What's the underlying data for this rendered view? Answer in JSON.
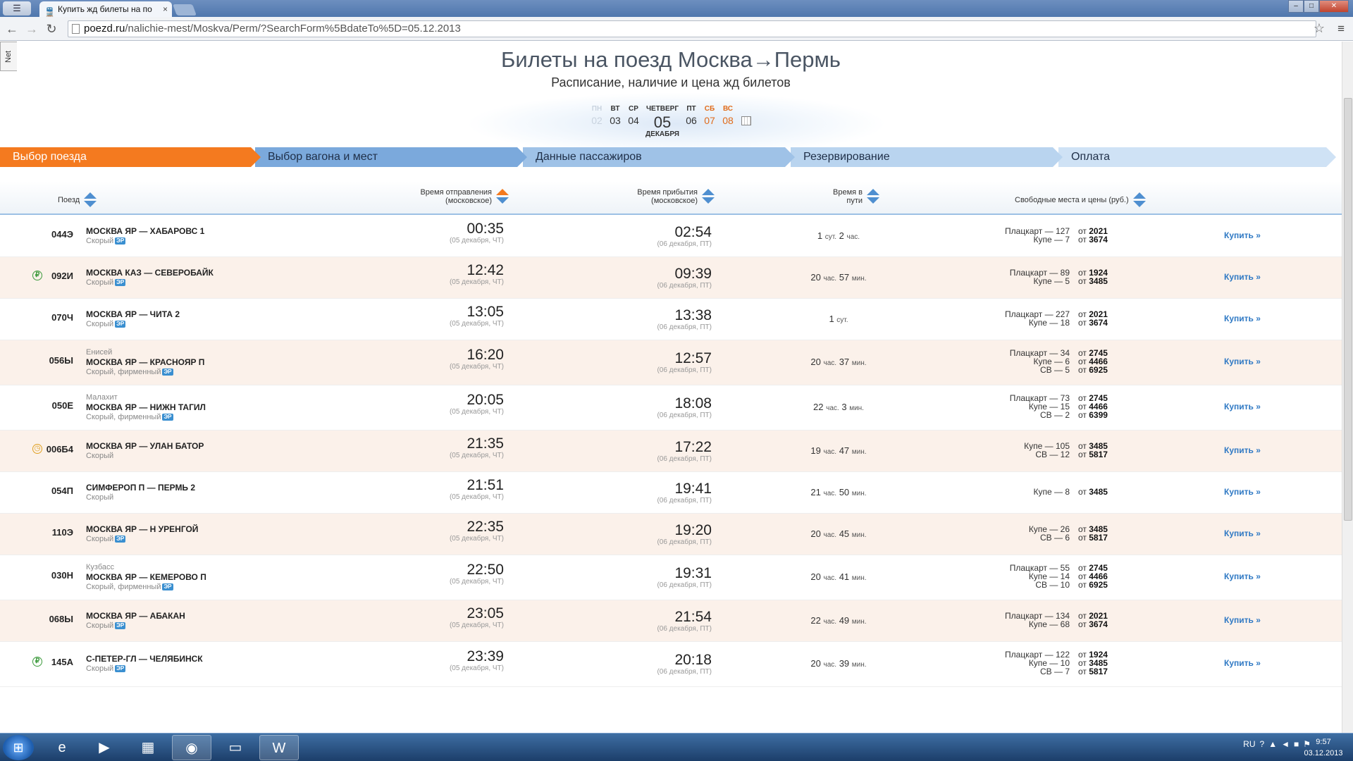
{
  "browser": {
    "tab_title": "Купить жд билеты на по",
    "url_host": "poezd.ru",
    "url_path": "/nalichie-mest/Moskva/Perm/?SearchForm%5BdateTo%5D=05.12.2013",
    "side_tab": "Net"
  },
  "page": {
    "title": "Билеты на поезд Москва→Пермь",
    "subtitle": "Расписание, наличие и цена жд билетов",
    "days": [
      {
        "name": "ПН",
        "date": "02",
        "state": "past"
      },
      {
        "name": "ВТ",
        "date": "03",
        "state": "normal"
      },
      {
        "name": "СР",
        "date": "04",
        "state": "normal"
      },
      {
        "name": "ЧЕТВЕРГ",
        "date": "05",
        "month": "ДЕКАБРЯ",
        "state": "selected"
      },
      {
        "name": "ПТ",
        "date": "06",
        "state": "normal"
      },
      {
        "name": "СБ",
        "date": "07",
        "state": "weekend"
      },
      {
        "name": "ВС",
        "date": "08",
        "state": "weekend"
      }
    ],
    "steps": [
      "Выбор поезда",
      "Выбор вагона и мест",
      "Данные пассажиров",
      "Резервирование",
      "Оплата"
    ],
    "headers": {
      "train": "Поезд",
      "departure": "Время отправления (московское)",
      "arrival": "Время прибытия (московское)",
      "duration": "Время в пути",
      "seats": "Свободные места и цены (руб.)"
    }
  },
  "trains": [
    {
      "num": "044Э",
      "badge": "",
      "brand": "",
      "route": "МОСКВА ЯР — ХАБАРОВС 1",
      "type": "Скорый",
      "er": true,
      "dep": "00:35",
      "dep_date": "(05 декабря, ЧТ)",
      "arr": "02:54",
      "arr_date": "(06 декабря, ПТ)",
      "dur_a": "1",
      "dur_au": "сут.",
      "dur_b": "2",
      "dur_bu": "час.",
      "seats": [
        [
          "Плацкарт — 127",
          "2021"
        ],
        [
          "Купе — 7",
          "3674"
        ]
      ],
      "buy": "Купить »"
    },
    {
      "num": "092И",
      "badge": "r",
      "brand": "",
      "route": "МОСКВА КАЗ — СЕВЕРОБАЙК",
      "type": "Скорый",
      "er": true,
      "dep": "12:42",
      "dep_date": "(05 декабря, ЧТ)",
      "arr": "09:39",
      "arr_date": "(06 декабря, ПТ)",
      "dur_a": "20",
      "dur_au": "час.",
      "dur_b": "57",
      "dur_bu": "мин.",
      "seats": [
        [
          "Плацкарт — 89",
          "1924"
        ],
        [
          "Купе — 5",
          "3485"
        ]
      ],
      "buy": "Купить »"
    },
    {
      "num": "070Ч",
      "badge": "",
      "brand": "",
      "route": "МОСКВА ЯР — ЧИТА 2",
      "type": "Скорый",
      "er": true,
      "dep": "13:05",
      "dep_date": "(05 декабря, ЧТ)",
      "arr": "13:38",
      "arr_date": "(06 декабря, ПТ)",
      "dur_a": "1",
      "dur_au": "сут.",
      "dur_b": "",
      "dur_bu": "",
      "seats": [
        [
          "Плацкарт — 227",
          "2021"
        ],
        [
          "Купе — 18",
          "3674"
        ]
      ],
      "buy": "Купить »"
    },
    {
      "num": "056Ы",
      "badge": "",
      "brand": "Енисей",
      "route": "МОСКВА ЯР — КРАСНОЯР П",
      "type": "Скорый, фирменный",
      "er": true,
      "dep": "16:20",
      "dep_date": "(05 декабря, ЧТ)",
      "arr": "12:57",
      "arr_date": "(06 декабря, ПТ)",
      "dur_a": "20",
      "dur_au": "час.",
      "dur_b": "37",
      "dur_bu": "мин.",
      "seats": [
        [
          "Плацкарт — 34",
          "2745"
        ],
        [
          "Купе — 6",
          "4466"
        ],
        [
          "СВ — 5",
          "6925"
        ]
      ],
      "buy": "Купить »"
    },
    {
      "num": "050Е",
      "badge": "",
      "brand": "Малахит",
      "route": "МОСКВА ЯР — НИЖН ТАГИЛ",
      "type": "Скорый, фирменный",
      "er": true,
      "dep": "20:05",
      "dep_date": "(05 декабря, ЧТ)",
      "arr": "18:08",
      "arr_date": "(06 декабря, ПТ)",
      "dur_a": "22",
      "dur_au": "час.",
      "dur_b": "3",
      "dur_bu": "мин.",
      "seats": [
        [
          "Плацкарт — 73",
          "2745"
        ],
        [
          "Купе — 15",
          "4466"
        ],
        [
          "СВ — 2",
          "6399"
        ]
      ],
      "buy": "Купить »"
    },
    {
      "num": "006Б4",
      "badge": "c",
      "brand": "",
      "route": "МОСКВА ЯР — УЛАН БАТОР",
      "type": "Скорый",
      "er": false,
      "dep": "21:35",
      "dep_date": "(05 декабря, ЧТ)",
      "arr": "17:22",
      "arr_date": "(06 декабря, ПТ)",
      "dur_a": "19",
      "dur_au": "час.",
      "dur_b": "47",
      "dur_bu": "мин.",
      "seats": [
        [
          "Купе — 105",
          "3485"
        ],
        [
          "СВ — 12",
          "5817"
        ]
      ],
      "buy": "Купить »"
    },
    {
      "num": "054П",
      "badge": "",
      "brand": "",
      "route": "СИМФЕРОП П — ПЕРМЬ 2",
      "type": "Скорый",
      "er": false,
      "dep": "21:51",
      "dep_date": "(05 декабря, ЧТ)",
      "arr": "19:41",
      "arr_date": "(06 декабря, ПТ)",
      "dur_a": "21",
      "dur_au": "час.",
      "dur_b": "50",
      "dur_bu": "мин.",
      "seats": [
        [
          "Купе — 8",
          "3485"
        ]
      ],
      "buy": "Купить »"
    },
    {
      "num": "110Э",
      "badge": "",
      "brand": "",
      "route": "МОСКВА ЯР — Н УРЕНГОЙ",
      "type": "Скорый",
      "er": true,
      "dep": "22:35",
      "dep_date": "(05 декабря, ЧТ)",
      "arr": "19:20",
      "arr_date": "(06 декабря, ПТ)",
      "dur_a": "20",
      "dur_au": "час.",
      "dur_b": "45",
      "dur_bu": "мин.",
      "seats": [
        [
          "Купе — 26",
          "3485"
        ],
        [
          "СВ — 6",
          "5817"
        ]
      ],
      "buy": "Купить »"
    },
    {
      "num": "030Н",
      "badge": "",
      "brand": "Кузбасс",
      "route": "МОСКВА ЯР — КЕМЕРОВО П",
      "type": "Скорый, фирменный",
      "er": true,
      "dep": "22:50",
      "dep_date": "(05 декабря, ЧТ)",
      "arr": "19:31",
      "arr_date": "(06 декабря, ПТ)",
      "dur_a": "20",
      "dur_au": "час.",
      "dur_b": "41",
      "dur_bu": "мин.",
      "seats": [
        [
          "Плацкарт — 55",
          "2745"
        ],
        [
          "Купе — 14",
          "4466"
        ],
        [
          "СВ — 10",
          "6925"
        ]
      ],
      "buy": "Купить »"
    },
    {
      "num": "068Ы",
      "badge": "",
      "brand": "",
      "route": "МОСКВА ЯР — АБАКАН",
      "type": "Скорый",
      "er": true,
      "dep": "23:05",
      "dep_date": "(05 декабря, ЧТ)",
      "arr": "21:54",
      "arr_date": "(06 декабря, ПТ)",
      "dur_a": "22",
      "dur_au": "час.",
      "dur_b": "49",
      "dur_bu": "мин.",
      "seats": [
        [
          "Плацкарт — 134",
          "2021"
        ],
        [
          "Купе — 68",
          "3674"
        ]
      ],
      "buy": "Купить »"
    },
    {
      "num": "145А",
      "badge": "r",
      "brand": "",
      "route": "С-ПЕТЕР-ГЛ — ЧЕЛЯБИНСК",
      "type": "Скорый",
      "er": true,
      "dep": "23:39",
      "dep_date": "(05 декабря, ЧТ)",
      "arr": "20:18",
      "arr_date": "(06 декабря, ПТ)",
      "dur_a": "20",
      "dur_au": "час.",
      "dur_b": "39",
      "dur_bu": "мин.",
      "seats": [
        [
          "Плацкарт — 122",
          "1924"
        ],
        [
          "Купе — 10",
          "3485"
        ],
        [
          "СВ — 7",
          "5817"
        ]
      ],
      "buy": "Купить »"
    }
  ],
  "labels": {
    "from": "от",
    "er": "ЭР"
  },
  "taskbar": {
    "lang": "RU",
    "time": "9:57",
    "date": "03.12.2013"
  }
}
